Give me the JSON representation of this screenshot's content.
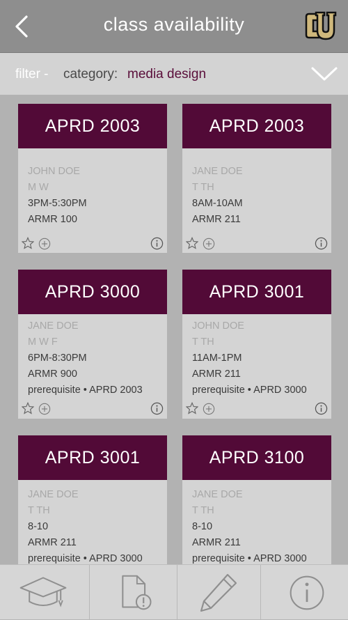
{
  "header": {
    "title": "class availability",
    "logo_text": "CU"
  },
  "filter": {
    "label": "filter -",
    "category_label": "category:",
    "category_value": "media design"
  },
  "cards": [
    {
      "course": "APRD 2003",
      "instructor": "JOHN DOE",
      "days": "M W",
      "time": "3PM-5:30PM",
      "room": "ARMR 100",
      "prereq": ""
    },
    {
      "course": "APRD 2003",
      "instructor": "JANE DOE",
      "days": "T TH",
      "time": "8AM-10AM",
      "room": "ARMR 211",
      "prereq": ""
    },
    {
      "course": "APRD 3000",
      "instructor": "JANE DOE",
      "days": "M W F",
      "time": "6PM-8:30PM",
      "room": "ARMR 900",
      "prereq": "prerequisite • APRD 2003"
    },
    {
      "course": "APRD 3001",
      "instructor": "JOHN DOE",
      "days": "T TH",
      "time": "11AM-1PM",
      "room": "ARMR 211",
      "prereq": "prerequisite • APRD 3000"
    },
    {
      "course": "APRD 3001",
      "instructor": "JANE DOE",
      "days": "T TH",
      "time": "8-10",
      "room": "ARMR 211",
      "prereq": "prerequisite • APRD 3000"
    },
    {
      "course": "APRD 3100",
      "instructor": "JANE DOE",
      "days": "T TH",
      "time": "8-10",
      "room": "ARMR 211",
      "prereq": "prerequisite • APRD 3000"
    }
  ],
  "tabs": [
    {
      "icon": "graduation-cap-icon"
    },
    {
      "icon": "document-alert-icon"
    },
    {
      "icon": "pencil-icon"
    },
    {
      "icon": "info-icon"
    }
  ],
  "colors": {
    "header": "#8e8e8e",
    "accent": "#520a37",
    "card": "#d4d4d4",
    "background": "#b2b2b2"
  }
}
